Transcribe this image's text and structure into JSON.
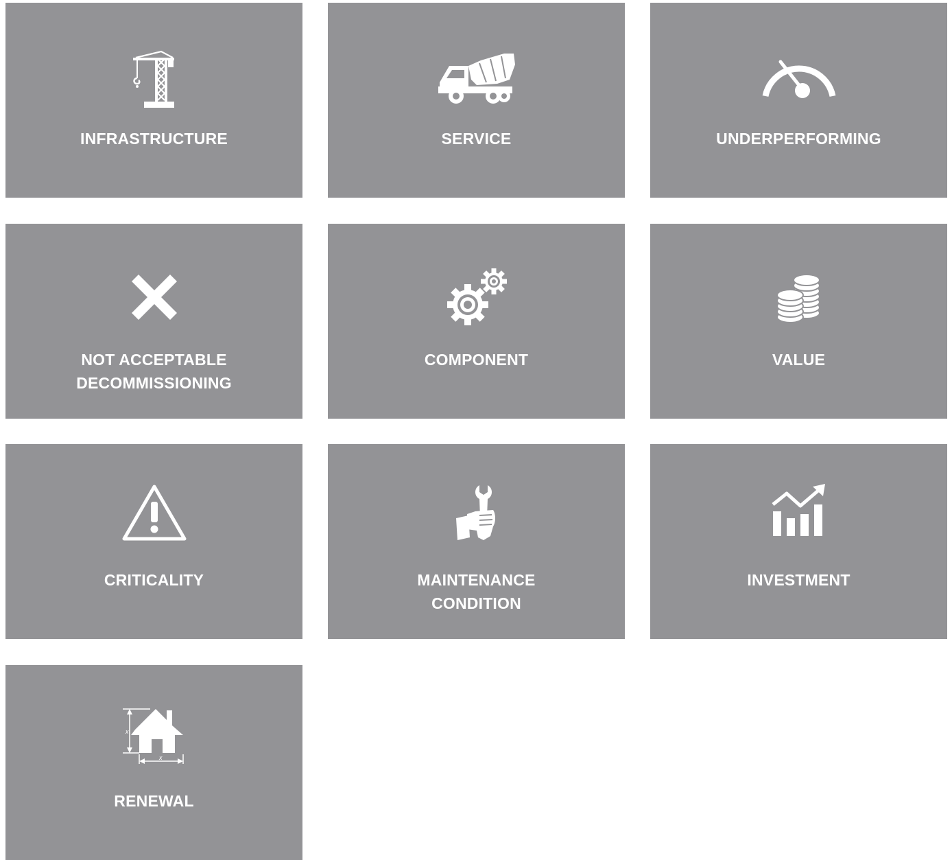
{
  "colors": {
    "tile_background": "#939396",
    "tile_text": "#ffffff",
    "page_background": "#ffffff"
  },
  "tiles": [
    {
      "id": "infrastructure",
      "icon": "crane-icon",
      "label_lines": [
        "INFRASTRUCTURE"
      ]
    },
    {
      "id": "service",
      "icon": "truck-icon",
      "label_lines": [
        "SERVICE"
      ]
    },
    {
      "id": "underperforming",
      "icon": "gauge-icon",
      "label_lines": [
        "UNDERPERFORMING"
      ]
    },
    {
      "id": "not-acceptable",
      "icon": "x-icon",
      "label_lines": [
        "NOT ACCEPTABLE",
        "DECOMMISSIONING"
      ]
    },
    {
      "id": "component",
      "icon": "gears-icon",
      "label_lines": [
        "COMPONENT"
      ]
    },
    {
      "id": "value",
      "icon": "coins-icon",
      "label_lines": [
        "VALUE"
      ]
    },
    {
      "id": "criticality",
      "icon": "warning-icon",
      "label_lines": [
        "CRITICALITY"
      ]
    },
    {
      "id": "maintenance-condition",
      "icon": "wrench-hand-icon",
      "label_lines": [
        "MAINTENANCE",
        "CONDITION"
      ]
    },
    {
      "id": "investment",
      "icon": "growth-chart-icon",
      "label_lines": [
        "INVESTMENT"
      ]
    },
    {
      "id": "renewal",
      "icon": "house-dimensions-icon",
      "label_lines": [
        "RENEWAL"
      ]
    }
  ]
}
